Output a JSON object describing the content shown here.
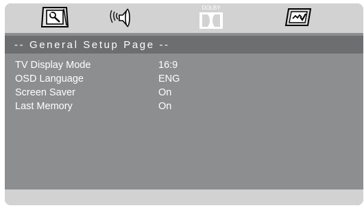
{
  "toolbar": {
    "tabs": [
      {
        "name": "general-setup",
        "icon": "tv-wrench-icon",
        "selected": true
      },
      {
        "name": "audio-setup",
        "icon": "speaker-icon",
        "selected": false
      },
      {
        "name": "dolby-setup",
        "icon": "dolby-icon",
        "label": "DOLBY",
        "selected": false
      },
      {
        "name": "video-setup",
        "icon": "picture-check-icon",
        "selected": false
      }
    ]
  },
  "header": {
    "title": "-- General Setup Page --"
  },
  "settings": [
    {
      "label": "TV Display Mode",
      "value": "16:9"
    },
    {
      "label": "OSD Language",
      "value": "ENG"
    },
    {
      "label": "Screen Saver",
      "value": "On"
    },
    {
      "label": "Last Memory",
      "value": "On"
    }
  ],
  "colors": {
    "panel": "#8c8e90",
    "header": "#6c6e70",
    "toolbar": "#d2d2d3",
    "text": "#ffffff"
  }
}
